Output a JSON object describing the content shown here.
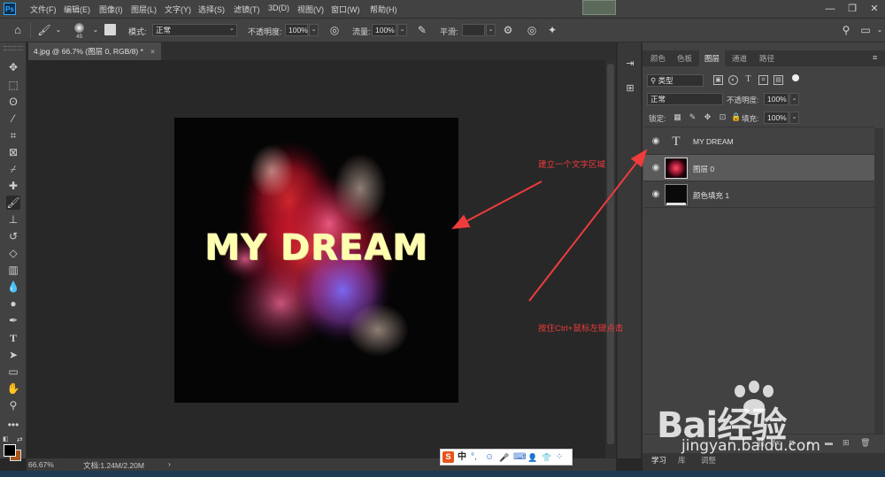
{
  "app": {
    "logo_text": "Ps"
  },
  "menu": [
    "文件(F)",
    "编辑(E)",
    "图像(I)",
    "图层(L)",
    "文字(Y)",
    "选择(S)",
    "滤镜(T)",
    "3D(D)",
    "视图(V)",
    "窗口(W)",
    "帮助(H)"
  ],
  "window_controls": {
    "minimize": "—",
    "restore": "❐",
    "close": "✕"
  },
  "options": {
    "brush_size": "45",
    "mode_label": "模式:",
    "mode_value": "正常",
    "opacity_label": "不透明度:",
    "opacity_value": "100%",
    "flow_label": "流量:",
    "flow_value": "100%",
    "smooth_label": "平滑:",
    "smooth_value": ""
  },
  "document": {
    "tab_title": "4.jpg @ 66.7% (图层 0, RGB/8) *",
    "close_glyph": "×",
    "art_text": "MY DREAM"
  },
  "status": {
    "zoom": "66.67%",
    "doc_info": "文档:1.24M/2.20M",
    "arrow": "›"
  },
  "ime": {
    "logo": "S",
    "items": [
      "中",
      "°,",
      "☺",
      "🎤",
      "⌨",
      "👤",
      "👕",
      "⁘"
    ]
  },
  "panel": {
    "tabs": [
      "颜色",
      "色板",
      "图层",
      "通道",
      "路径"
    ],
    "active_tab": "图层",
    "filter_kind": "类型",
    "blend_mode": "正常",
    "opacity_label": "不透明度:",
    "opacity_value": "100%",
    "lock_label": "锁定:",
    "fill_label": "填充:",
    "fill_value": "100%",
    "layers": [
      {
        "name": "MY DREAM",
        "kind": "text",
        "visible": true,
        "selected": false
      },
      {
        "name": "图层 0",
        "kind": "image",
        "visible": true,
        "selected": true
      },
      {
        "name": "颜色填充 1",
        "kind": "fill",
        "visible": true,
        "selected": false
      }
    ]
  },
  "bottom_tabs": [
    "学习",
    "库",
    "调整"
  ],
  "annotations": {
    "text_area": "建立一个文字区域",
    "ctrl_click": "按住Ctrl+鼠标左键点击"
  },
  "watermark": {
    "logo": "Bai经验",
    "url": "jingyan.baidu.com"
  },
  "colors": {
    "foreground": "#000000",
    "background": "#a8561c",
    "annotation": "#ee3b3b",
    "art_text": "#ffffb0"
  }
}
